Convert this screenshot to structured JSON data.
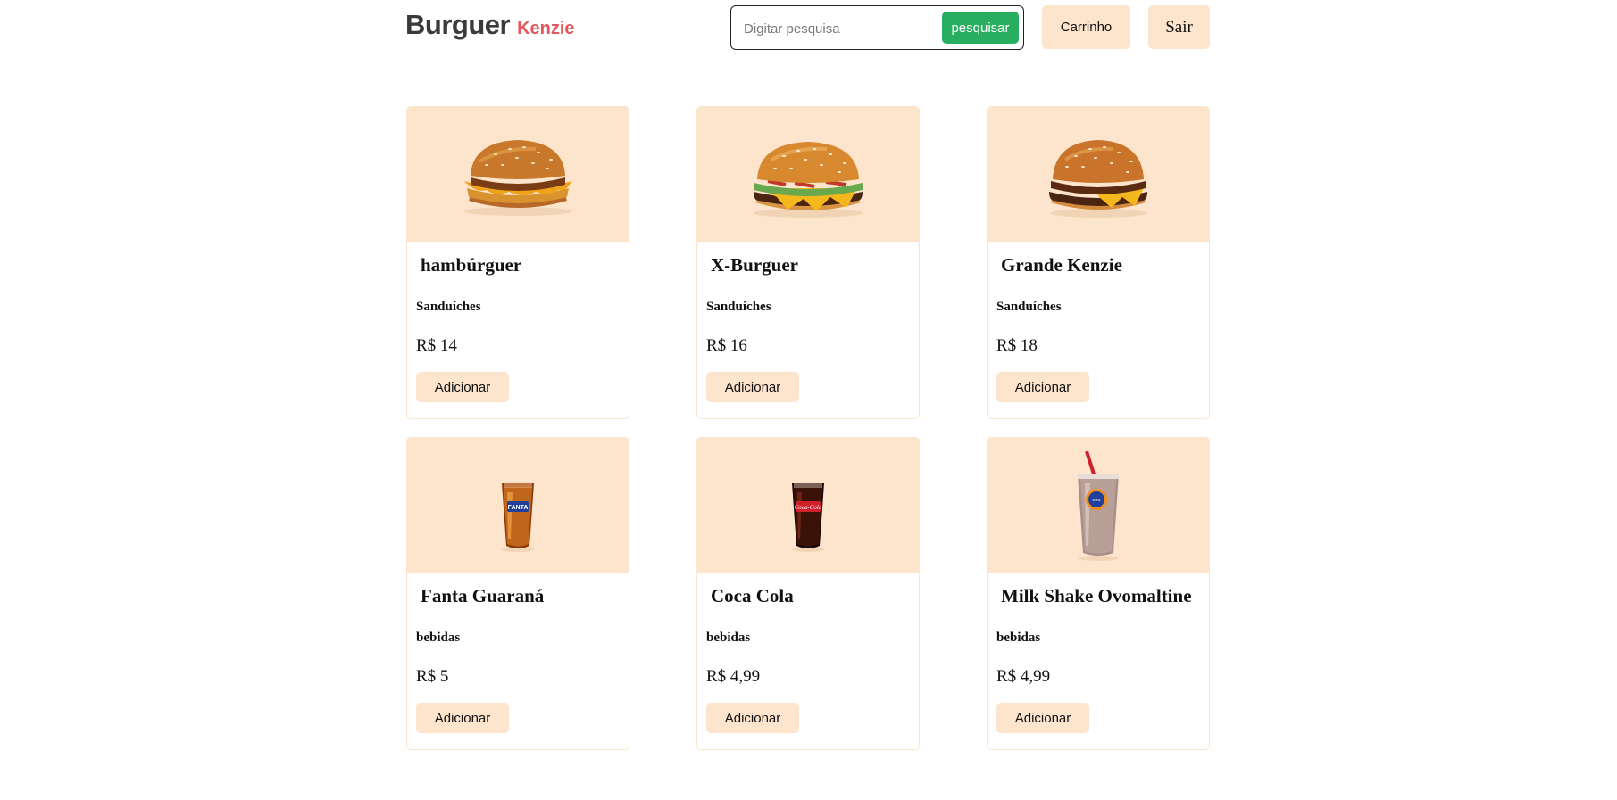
{
  "header": {
    "logo_main": "Burguer",
    "logo_sub": "Kenzie",
    "search_placeholder": "Digitar pesquisa",
    "search_value": "",
    "search_button": "pesquisar",
    "cart_button": "Carrinho",
    "logout_button": "Sair"
  },
  "products": [
    {
      "name": "hambúrguer",
      "category": "Sanduíches",
      "price": "R$ 14",
      "button": "Adicionar",
      "image_icon": "chicken-burger-image"
    },
    {
      "name": "X-Burguer",
      "category": "Sanduíches",
      "price": "R$ 16",
      "button": "Adicionar",
      "image_icon": "cheeseburger-image"
    },
    {
      "name": "Grande Kenzie",
      "category": "Sanduíches",
      "price": "R$ 18",
      "button": "Adicionar",
      "image_icon": "double-burger-image"
    },
    {
      "name": "Fanta Guaraná",
      "category": "bebidas",
      "price": "R$ 5",
      "button": "Adicionar",
      "image_icon": "fanta-cup-image"
    },
    {
      "name": "Coca Cola",
      "category": "bebidas",
      "price": "R$ 4,99",
      "button": "Adicionar",
      "image_icon": "coca-cola-cup-image"
    },
    {
      "name": "Milk Shake Ovomaltine",
      "category": "bebidas",
      "price": "R$ 4,99",
      "button": "Adicionar",
      "image_icon": "milkshake-image"
    }
  ],
  "colors": {
    "accent": "#fde4cc",
    "search_button": "#27ae60",
    "logo_sub": "#e3585b"
  }
}
